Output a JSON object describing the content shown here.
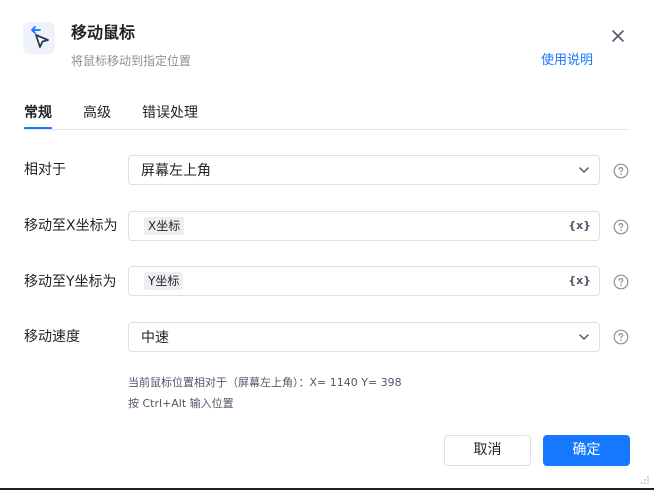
{
  "header": {
    "title": "移动鼠标",
    "subtitle": "将鼠标移动到指定位置",
    "help_link": "使用说明",
    "icon": "mouse-move-icon"
  },
  "tabs": [
    {
      "label": "常规",
      "active": true
    },
    {
      "label": "高级",
      "active": false
    },
    {
      "label": "错误处理",
      "active": false
    }
  ],
  "form": {
    "relative_to": {
      "label": "相对于",
      "value": "屏幕左上角"
    },
    "move_x": {
      "label": "移动至X坐标为",
      "value": "X坐标",
      "var_icon": "{x}"
    },
    "move_y": {
      "label": "移动至Y坐标为",
      "value": "Y坐标",
      "var_icon": "{x}"
    },
    "speed": {
      "label": "移动速度",
      "value": "中速"
    }
  },
  "hint": {
    "position_line": "当前鼠标位置相对于（屏幕左上角）：X= 1140   Y= 398",
    "shortcut_line": "按 Ctrl+Alt 输入位置"
  },
  "footer": {
    "cancel_label": "取消",
    "ok_label": "确定"
  },
  "colors": {
    "accent": "#1677ff",
    "text": "#1f2329",
    "muted": "#8a9099",
    "border": "#dcdfe5"
  }
}
